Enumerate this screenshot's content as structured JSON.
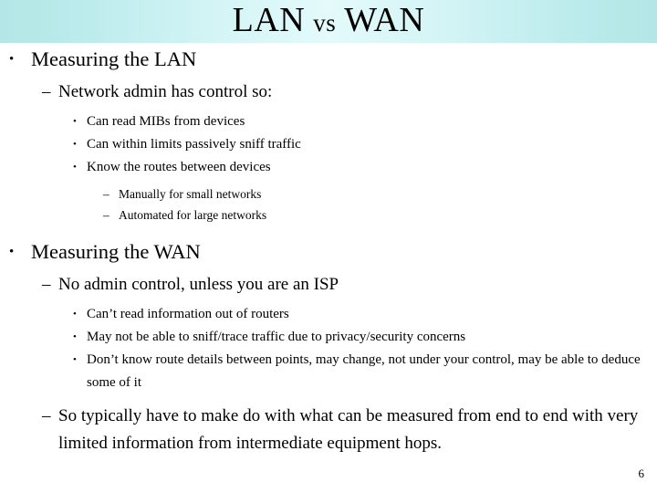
{
  "slide": {
    "title_part1": "LAN",
    "title_vs": "vs",
    "title_part2": "WAN",
    "title_full": "LAN vs WAN",
    "page_number": "6",
    "colors": {
      "title_band_edge": "#b3e6e6",
      "title_band_center": "#e4fafb",
      "text": "#000000",
      "background": "#ffffff"
    },
    "markers": {
      "bullet": "•",
      "dash": "–"
    },
    "content": [
      {
        "level": 1,
        "marker": "bullet",
        "text": "Measuring the LAN"
      },
      {
        "level": 2,
        "marker": "dash",
        "text": "Network admin has control so:"
      },
      {
        "level": 3,
        "marker": "bullet",
        "text": "Can read MIBs from devices"
      },
      {
        "level": 3,
        "marker": "bullet",
        "text": "Can within limits passively sniff traffic"
      },
      {
        "level": 3,
        "marker": "bullet",
        "text": "Know the routes between devices"
      },
      {
        "level": 4,
        "marker": "dash",
        "text": "Manually for small networks"
      },
      {
        "level": 4,
        "marker": "dash",
        "text": "Automated for large networks"
      },
      {
        "level": 1,
        "marker": "bullet",
        "text": "Measuring the WAN"
      },
      {
        "level": 2,
        "marker": "dash",
        "text": "No admin control, unless you are an ISP"
      },
      {
        "level": 3,
        "marker": "bullet",
        "text": "Can’t read information out of routers"
      },
      {
        "level": 3,
        "marker": "bullet",
        "text": "May not be able to sniff/trace traffic due to privacy/security concerns"
      },
      {
        "level": 3,
        "marker": "bullet",
        "text": "Don’t know route details between points, may change, not under your control, may be able to deduce some of it"
      },
      {
        "level": 2,
        "marker": "dash",
        "text": "So typically have to make do with what can be measured from end to end with very limited information from intermediate equipment hops."
      }
    ]
  }
}
